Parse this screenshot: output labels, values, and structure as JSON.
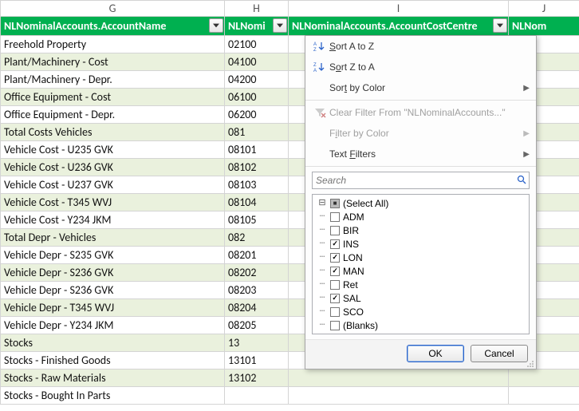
{
  "columns": {
    "g": "G",
    "h": "H",
    "i": "I",
    "j": "J"
  },
  "headers": {
    "g": "NLNominalAccounts.AccountName",
    "h": "NLNomi",
    "i": "NLNominalAccounts.AccountCostCentre",
    "j": "NLNom"
  },
  "rows": [
    {
      "name": "Freehold Property",
      "code": "02100"
    },
    {
      "name": "Plant/Machinery - Cost",
      "code": "04100"
    },
    {
      "name": "Plant/Machinery - Depr.",
      "code": "04200"
    },
    {
      "name": "Office Equipment - Cost",
      "code": "06100"
    },
    {
      "name": "Office Equipment - Depr.",
      "code": "06200"
    },
    {
      "name": "Total Costs Vehicles",
      "code": "081"
    },
    {
      "name": "Vehicle Cost - U235 GVK",
      "code": "08101"
    },
    {
      "name": "Vehicle Cost - U236 GVK",
      "code": "08102"
    },
    {
      "name": "Vehicle Cost - U237 GVK",
      "code": "08103"
    },
    {
      "name": "Vehicle Cost - T345 WVJ",
      "code": "08104"
    },
    {
      "name": "Vehicle Cost - Y234 JKM",
      "code": "08105"
    },
    {
      "name": "Total Depr - Vehicles",
      "code": "082"
    },
    {
      "name": "Vehicle Depr - S235 GVK",
      "code": "08201"
    },
    {
      "name": "Vehicle Depr - S236 GVK",
      "code": "08202"
    },
    {
      "name": "Vehicle Depr - S236 GVK",
      "code": "08203"
    },
    {
      "name": "Vehicle Depr - T345 WVJ",
      "code": "08204"
    },
    {
      "name": "Vehicle Depr - Y234 JKM",
      "code": "08205"
    },
    {
      "name": "Stocks",
      "code": "13"
    },
    {
      "name": "Stocks - Finished Goods",
      "code": "13101"
    },
    {
      "name": "Stocks - Raw Materials",
      "code": "13102"
    },
    {
      "name": "Stocks - Bought In Parts",
      "code": ""
    }
  ],
  "menu": {
    "sort_az": "Sort A to Z",
    "sort_za": "Sort Z to A",
    "sort_color": "Sort by Color",
    "clear": "Clear Filter From \"NLNominalAccounts...\"",
    "filter_color": "Filter by Color",
    "text_filters": "Text Filters",
    "search_placeholder": "Search",
    "items": [
      {
        "label": "(Select All)",
        "state": "mixed"
      },
      {
        "label": "ADM",
        "state": "unchecked"
      },
      {
        "label": "BIR",
        "state": "unchecked"
      },
      {
        "label": "INS",
        "state": "checked"
      },
      {
        "label": "LON",
        "state": "checked"
      },
      {
        "label": "MAN",
        "state": "checked"
      },
      {
        "label": "Ret",
        "state": "unchecked"
      },
      {
        "label": "SAL",
        "state": "checked"
      },
      {
        "label": "SCO",
        "state": "unchecked"
      },
      {
        "label": "(Blanks)",
        "state": "unchecked"
      }
    ],
    "ok": "OK",
    "cancel": "Cancel"
  }
}
